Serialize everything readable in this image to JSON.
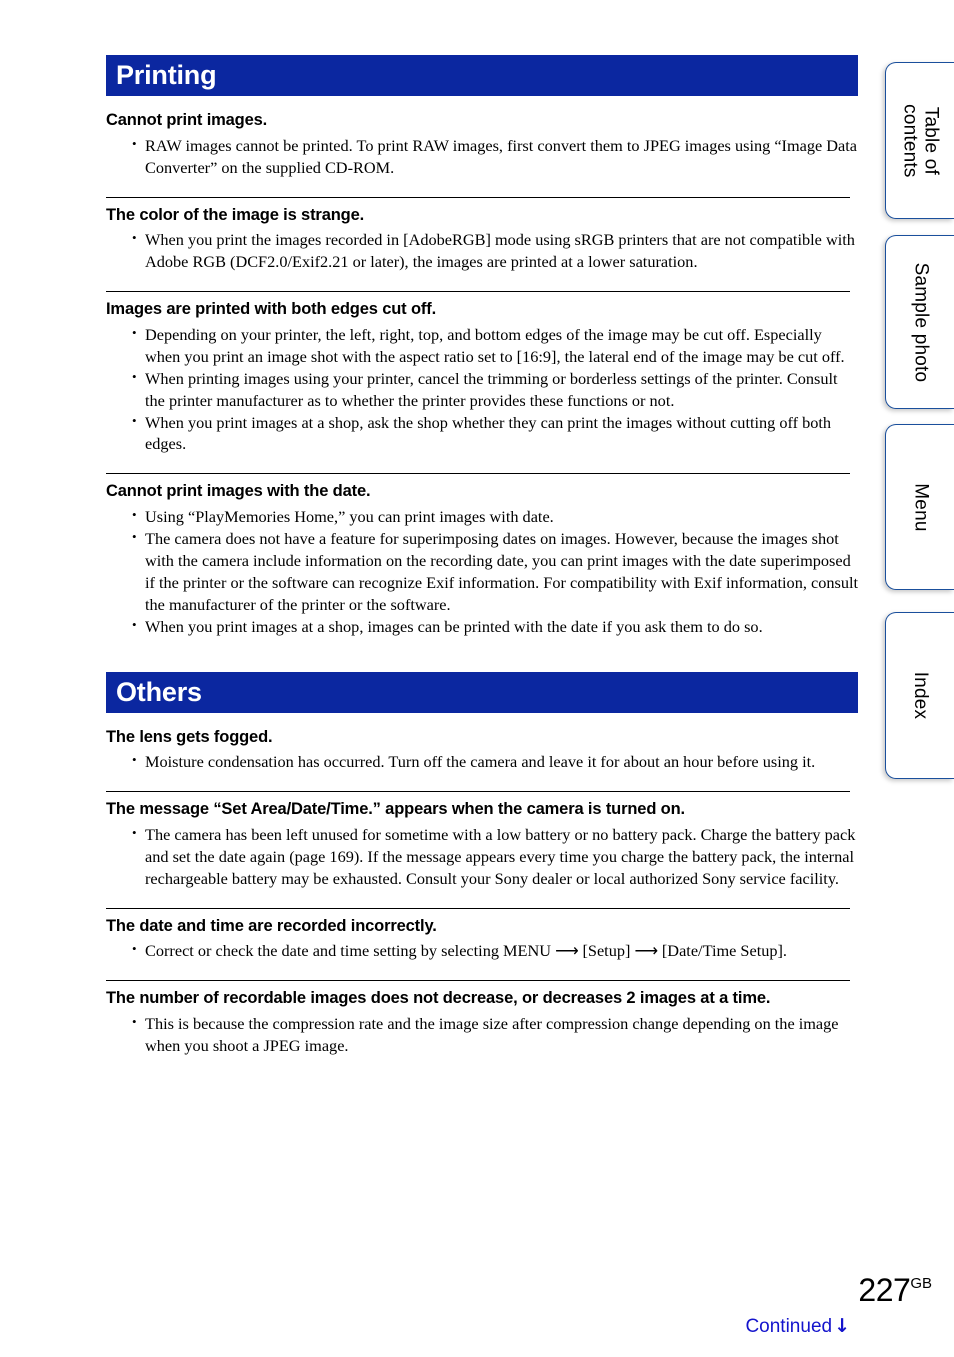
{
  "document": {
    "page_number": "227",
    "page_number_suffix": "GB",
    "continued_label": "Continued",
    "continued_arrow": "↓"
  },
  "side_tabs": [
    {
      "label": "Table of\ncontents",
      "name": "table-of-contents"
    },
    {
      "label": "Sample photo",
      "name": "sample-photo"
    },
    {
      "label": "Menu",
      "name": "menu"
    },
    {
      "label": "Index",
      "name": "index"
    }
  ],
  "sections": [
    {
      "title": "Printing",
      "blocks": [
        {
          "heading": "Cannot print images.",
          "rule_above": false,
          "bullets": [
            "RAW images cannot be printed. To print RAW images, first convert them to JPEG images using “Image Data Converter” on the supplied CD-ROM."
          ]
        },
        {
          "heading": "The color of the image is strange.",
          "rule_above": true,
          "bullets": [
            "When you print the images recorded in [AdobeRGB] mode using sRGB printers that are not compatible with Adobe RGB (DCF2.0/Exif2.21 or later), the images are printed at a lower saturation."
          ]
        },
        {
          "heading": "Images are printed with both edges cut off.",
          "rule_above": true,
          "bullets": [
            "Depending on your printer, the left, right, top, and bottom edges of the image may be cut off. Especially when you print an image shot with the aspect ratio set to [16:9], the lateral end of the image may be cut off.",
            "When printing images using your printer, cancel the trimming or borderless settings of the printer. Consult the printer manufacturer as to whether the printer provides these functions or not.",
            "When you print images at a shop, ask the shop whether they can print the images without cutting off both edges."
          ]
        },
        {
          "heading": "Cannot print images with the date.",
          "rule_above": true,
          "bullets": [
            "Using “PlayMemories Home,” you can print images with date.",
            "The camera does not have a feature for superimposing dates on images. However, because the images shot with the camera include information on the recording date, you can print images with the date superimposed if the printer or the software can recognize Exif information. For compatibility with Exif information, consult the manufacturer of the printer or the software.",
            "When you print images at a shop, images can be printed with the date if you ask them to do so."
          ]
        }
      ]
    },
    {
      "title": "Others",
      "blocks": [
        {
          "heading": "The lens gets fogged.",
          "rule_above": false,
          "bullets": [
            "Moisture condensation has occurred. Turn off the camera and leave it for about an hour before using it."
          ]
        },
        {
          "heading": "The message “Set Area/Date/Time.” appears when the camera is turned on.",
          "rule_above": true,
          "bullets": [
            "The camera has been left unused for sometime with a low battery or no battery pack. Charge the battery pack and set the date again (page 169). If the message appears every time you charge the battery pack, the internal rechargeable battery may be exhausted. Consult your Sony dealer or local authorized Sony service facility."
          ]
        },
        {
          "heading": "The date and time are recorded incorrectly.",
          "rule_above": true,
          "bullets": [
            "Correct or check the date and time setting by selecting MENU ⟶ [Setup] ⟶ [Date/Time Setup]."
          ]
        },
        {
          "heading": "The number of recordable images does not decrease, or decreases 2 images at a time.",
          "rule_above": true,
          "bullets": [
            "This is because the compression rate and the image size after compression change depending on the image when you shoot a JPEG image."
          ]
        }
      ]
    }
  ]
}
